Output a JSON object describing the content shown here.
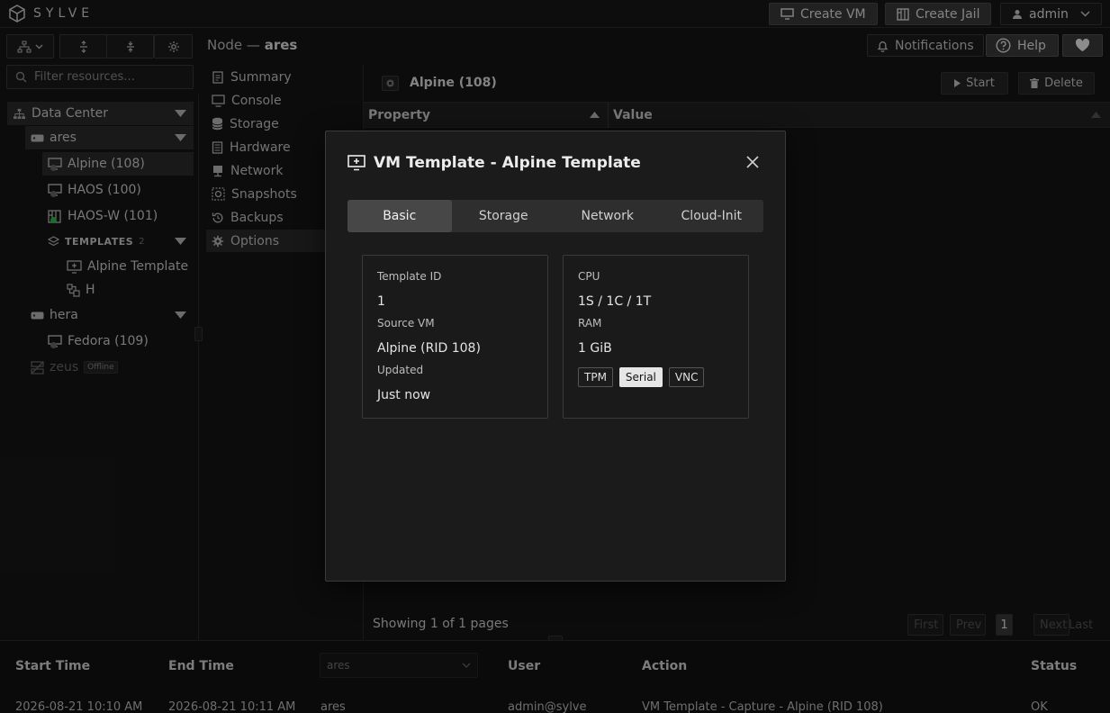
{
  "brand": {
    "name": "SYLVE"
  },
  "topbar": {
    "create_vm": "Create VM",
    "create_jail": "Create Jail",
    "user": "admin"
  },
  "toolbar": {
    "filter_placeholder": "Filter resources..."
  },
  "node_header": {
    "prefix": "Node —",
    "name": "ares"
  },
  "header_buttons": {
    "notifications": "Notifications",
    "help": "Help"
  },
  "tree": {
    "datacenter": "Data Center",
    "nodes": [
      {
        "name": "ares"
      },
      {
        "name": "hera"
      },
      {
        "name": "zeus",
        "badge": "Offline"
      }
    ],
    "ares_vms": [
      "Alpine (108)",
      "HAOS (100)",
      "HAOS-W (101)"
    ],
    "templates_label": "TEMPLATES",
    "templates_count": "2",
    "templates": [
      "Alpine Template",
      "H"
    ],
    "hera_vms": [
      "Fedora (109)"
    ]
  },
  "menu": [
    "Summary",
    "Console",
    "Storage",
    "Hardware",
    "Network",
    "Snapshots",
    "Backups",
    "Options"
  ],
  "panel": {
    "vm_title": "Alpine (108)",
    "start": "Start",
    "delete": "Delete",
    "col_property": "Property",
    "col_value": "Value",
    "pagination_text": "Showing 1 of 1 pages",
    "first": "First",
    "prev": "Prev",
    "page": "1",
    "next": "Next",
    "last": "Last"
  },
  "log": {
    "headers": [
      "Start Time",
      "End Time",
      "User",
      "Action",
      "Status"
    ],
    "node_filter": "ares",
    "row": {
      "start": "2026-08-21 10:10 AM",
      "end": "2026-08-21 10:11 AM",
      "node": "ares",
      "user": "admin@sylve",
      "action": "VM Template - Capture - Alpine (RID 108)",
      "status": "OK"
    }
  },
  "modal": {
    "title": "VM Template - Alpine Template",
    "tabs": [
      "Basic",
      "Storage",
      "Network",
      "Cloud-Init"
    ],
    "left_card": [
      {
        "label": "Template ID",
        "value": "1"
      },
      {
        "label": "Source VM",
        "value": "Alpine (RID 108)"
      },
      {
        "label": "Updated",
        "value": "Just now"
      }
    ],
    "right_card": [
      {
        "label": "CPU",
        "value": "1S / 1C / 1T"
      },
      {
        "label": "RAM",
        "value": "1 GiB"
      }
    ],
    "chips": [
      {
        "label": "TPM",
        "active": false
      },
      {
        "label": "Serial",
        "active": true
      },
      {
        "label": "VNC",
        "active": false
      }
    ]
  }
}
